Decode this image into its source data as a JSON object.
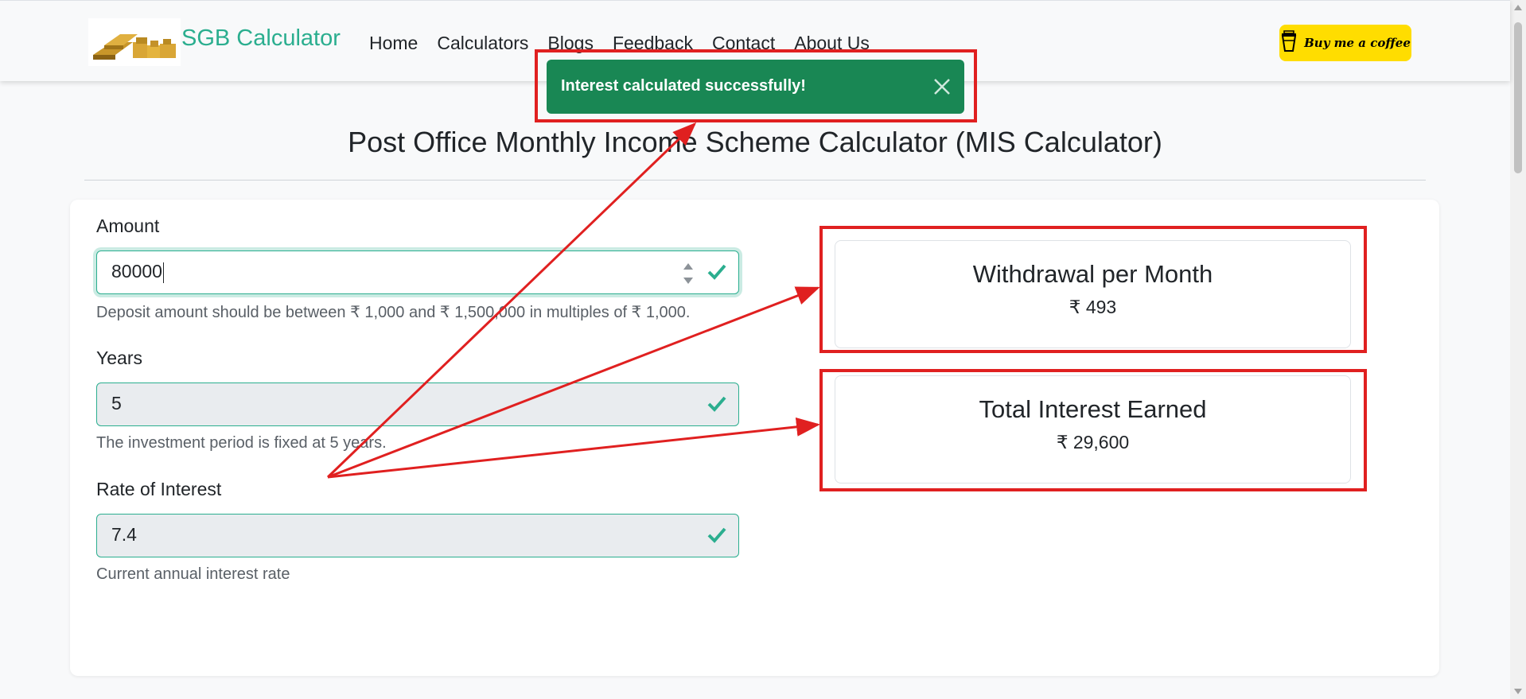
{
  "navbar": {
    "brand": "SGB Calculator",
    "logo_icon": "gold-bars-logo",
    "links": [
      "Home",
      "Calculators",
      "Blogs",
      "Feedback",
      "Contact",
      "About Us"
    ],
    "coffee_label": "Buy me a coffee",
    "coffee_icon": "coffee-cup-icon",
    "coffee_color": "#ffdd00"
  },
  "toast": {
    "message": "Interest calculated successfully!",
    "color": "#198754"
  },
  "page": {
    "title": "Post Office Monthly Income Scheme Calculator (MIS Calculator)"
  },
  "form": {
    "amount": {
      "label": "Amount",
      "value": "80000",
      "hint": "Deposit amount should be between ₹ 1,000 and ₹ 1,500,000 in multiples of ₹ 1,000."
    },
    "years": {
      "label": "Years",
      "value": "5",
      "hint": "The investment period is fixed at 5 years."
    },
    "rate": {
      "label": "Rate of Interest",
      "value": "7.4",
      "hint": "Current annual interest rate"
    }
  },
  "results": {
    "withdrawal": {
      "title": "Withdrawal per Month",
      "value": "₹ 493"
    },
    "interest": {
      "title": "Total Interest Earned",
      "value": "₹ 29,600"
    }
  },
  "colors": {
    "accent": "#2bae8f",
    "annotation": "#e02020"
  }
}
